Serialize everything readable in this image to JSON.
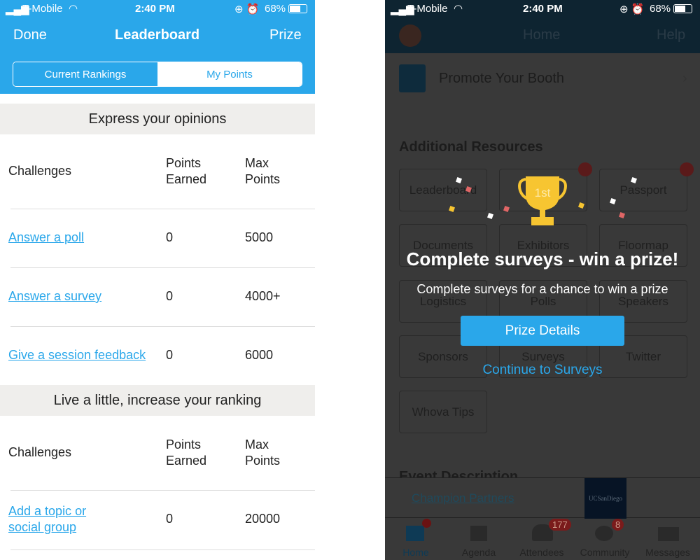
{
  "status_bar": {
    "carrier": "T-Mobile",
    "time": "2:40 PM",
    "battery": "68%"
  },
  "leaderboard": {
    "nav": {
      "left": "Done",
      "title": "Leaderboard",
      "right": "Prize"
    },
    "segments": [
      "Current Rankings",
      "My Points"
    ],
    "sections": [
      {
        "title": "Express your opinions",
        "headers": [
          "Challenges",
          "Points\nEarned",
          "Max\nPoints"
        ],
        "rows": [
          {
            "challenge": "Answer a poll",
            "earned": "0",
            "max": "5000"
          },
          {
            "challenge": "Answer a survey",
            "earned": "0",
            "max": "4000+"
          },
          {
            "challenge": "Give a session feedback",
            "earned": "0",
            "max": "6000"
          }
        ]
      },
      {
        "title": "Live a little, increase your ranking",
        "headers": [
          "Challenges",
          "Points\nEarned",
          "Max\nPoints"
        ],
        "rows": [
          {
            "challenge": "Add a topic or social group",
            "earned": "0",
            "max": "20000"
          }
        ]
      }
    ]
  },
  "home": {
    "nav": {
      "title": "Home",
      "right": "Help"
    },
    "promote": "Promote Your Booth",
    "resources_title": "Additional Resources",
    "tiles": [
      "Leaderboard",
      "",
      "Passport",
      "Documents",
      "Exhibitors",
      "Floormap",
      "Logistics",
      "Polls",
      "Speakers",
      "Sponsors",
      "Surveys",
      "Twitter",
      "Whova Tips"
    ],
    "event_description": "Event Description",
    "partners_link": "Champion Partners",
    "partner_logo": "UCSanDiego",
    "tabs": [
      {
        "label": "Home"
      },
      {
        "label": "Agenda"
      },
      {
        "label": "Attendees",
        "badge": "177"
      },
      {
        "label": "Community",
        "badge": "8"
      },
      {
        "label": "Messages"
      }
    ]
  },
  "popup": {
    "trophy_text": "1st",
    "title": "Complete surveys - win a prize!",
    "subtitle": "Complete surveys for a chance to win a prize",
    "primary": "Prize Details",
    "secondary": "Continue to Surveys"
  },
  "colors": {
    "accent": "#2aa7ea",
    "trophy": "#f7c531",
    "nav_dark": "#0e2431"
  }
}
